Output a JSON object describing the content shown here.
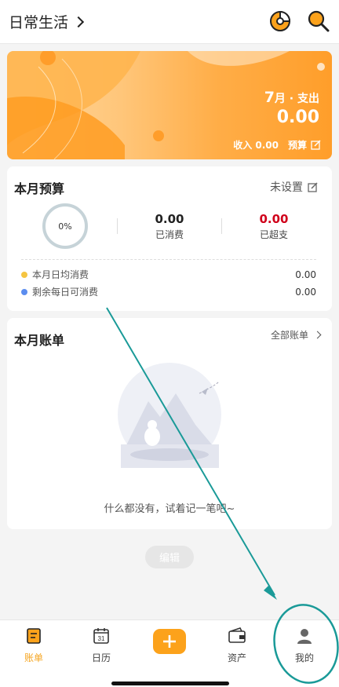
{
  "header": {
    "title": "日常生活",
    "chart_icon": "pie-chart-icon",
    "search_icon": "search-icon"
  },
  "banner": {
    "month_num": "7",
    "month_suffix": "月 · 支出",
    "expense": "0.00",
    "income_label": "收入 0.00",
    "budget_label": "预算"
  },
  "budget": {
    "title": "本月预算",
    "unset_label": "未设置",
    "percent": "0%",
    "spent_value": "0.00",
    "spent_label": "已消费",
    "over_value": "0.00",
    "over_label": "已超支",
    "daily_avg_label": "本月日均消费",
    "daily_avg_value": "0.00",
    "remain_label": "剩余每日可消费",
    "remain_value": "0.00",
    "colors": {
      "over": "#d0021b",
      "dot_yellow": "#f5c542",
      "dot_blue": "#5b8def"
    }
  },
  "bills": {
    "title": "本月账单",
    "all_label": "全部账单",
    "empty_text": "什么都没有，试着记一笔吧~"
  },
  "edit_label": "编辑",
  "tabbar": {
    "items": [
      {
        "label": "账单",
        "icon": "ledger-icon",
        "active": true
      },
      {
        "label": "日历",
        "icon": "calendar-icon",
        "calendar_day": "31"
      },
      {
        "label": "资产",
        "icon": "wallet-icon"
      },
      {
        "label": "我的",
        "icon": "user-icon"
      }
    ],
    "accent": "#fca21b"
  }
}
